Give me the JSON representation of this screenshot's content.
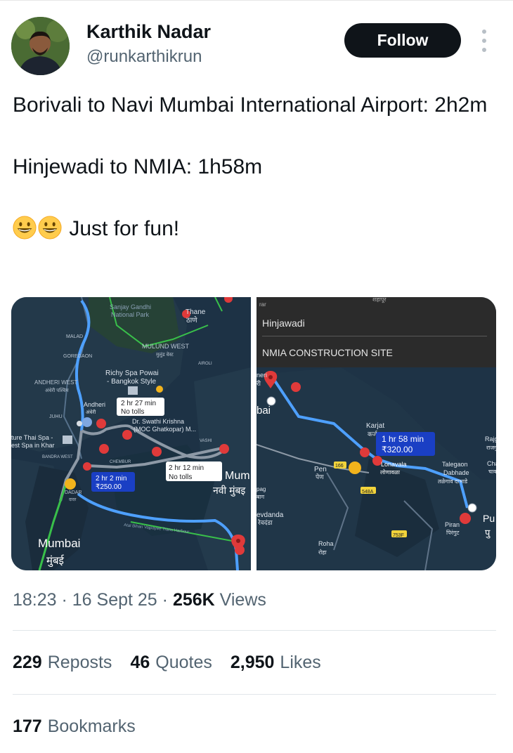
{
  "user": {
    "name": "Karthik Nadar",
    "handle": "@runkarthikrun",
    "follow_label": "Follow"
  },
  "tweet": {
    "line1": "Borivali to Navi Mumbai International Airport: 2h2m",
    "line2": "Hinjewadi to NMIA: 1h58m",
    "line3": "Just for fun!"
  },
  "map_left": {
    "labels": {
      "park": "Sanjay Gandhi\nNational Park",
      "thane": "Thane",
      "thane_mr": "ठाणे",
      "malad": "MALAD",
      "goregaon": "GOREGAON",
      "mulund": "MULUND WEST",
      "mulund_mr": "मुलुंड वेस्ट",
      "airoli": "AIROLI",
      "andheri_west": "ANDHERI WEST",
      "andheri_west_mr": "अंधेरी पश्चिम",
      "richy": "Richy Spa Powai",
      "bangkok": "- Bangkok Style",
      "juhu": "JUHU",
      "andheri": "Andheri",
      "andheri_mr": "अंधेरी",
      "swathi": "Dr. Swathi Krishna",
      "moc": "(MOC Ghatkopar) M...",
      "thai_spa": "ture Thai Spa -",
      "best_spa": "est Spa in Khar",
      "bandra": "BANDRA WEST",
      "vashi": "VASHI",
      "chembur": "CHEMBUR",
      "dadar": "DADAR",
      "dadar_mr": "दादर",
      "mumbai": "Mumbai",
      "mumbai_mr": "मुंबई",
      "navi_mumbai": "Mum",
      "navi_mumbai_mr": "नवी मुंबइ",
      "atal": "Atal Bihari Vajpayee Trans Harbour"
    },
    "callouts": [
      {
        "time": "2 hr 27 min",
        "sub": "No tolls"
      },
      {
        "time": "2 hr 12 min",
        "sub": "No tolls"
      },
      {
        "time": "2 hr 2 min",
        "sub": "₹250.00"
      }
    ]
  },
  "map_right": {
    "banner_top": "rar",
    "from": "Hinjawadi",
    "to": "NMIA CONSTRUCTION SITE",
    "labels": {
      "top_mr": "शहापूर",
      "neral": "neri",
      "neral_mr": "री",
      "bai": "bai",
      "karjat": "Karjat",
      "karjat_mr": "कर्ज",
      "pen": "Pen",
      "pen_mr": "पेण",
      "lonavala": "Lonavala",
      "lonavala_mr": "लोणावळा",
      "talegaon": "Talegaon",
      "dabhade": "Dabhade",
      "talegaon_mr": "तळेगाव दाभाडे",
      "rajgur": "Rajgur",
      "rajgur_mr": "राजगु",
      "chak": "Chak",
      "chak_mr": "चाक",
      "pag": "pag",
      "pag_mr": "बाग",
      "alibag": "evdanda",
      "alibag_mr": "रेवदंडा",
      "roha": "Roha",
      "roha_mr": "रोहा",
      "pirangut": "Piran",
      "pirangut_mr": "पिरंगुट",
      "pu": "Pu",
      "pu_mr": "पु",
      "r166": "166",
      "r548": "548A",
      "r753": "753F"
    },
    "callout": {
      "time": "1 hr 58 min",
      "sub": "₹320.00"
    }
  },
  "meta": {
    "time": "18:23 · 16 Sept 25 · ",
    "views_count": "256K",
    "views_label": " Views"
  },
  "stats": {
    "reposts_count": "229",
    "reposts_label": "Reposts",
    "quotes_count": "46",
    "quotes_label": "Quotes",
    "likes_count": "2,950",
    "likes_label": "Likes",
    "bookmarks_count": "177",
    "bookmarks_label": "Bookmarks"
  },
  "colors": {
    "follow_bg": "#0f1419",
    "map_bg": "#1f3448",
    "route_blue": "#3d8fe0",
    "route_gray": "#8d99a6",
    "marker_red": "#e03a3a",
    "callout_blue": "#1a3fc4"
  },
  "icons": [
    "more-vertical-icon",
    "grinning-emoji-icon",
    "location-pin-icon"
  ]
}
